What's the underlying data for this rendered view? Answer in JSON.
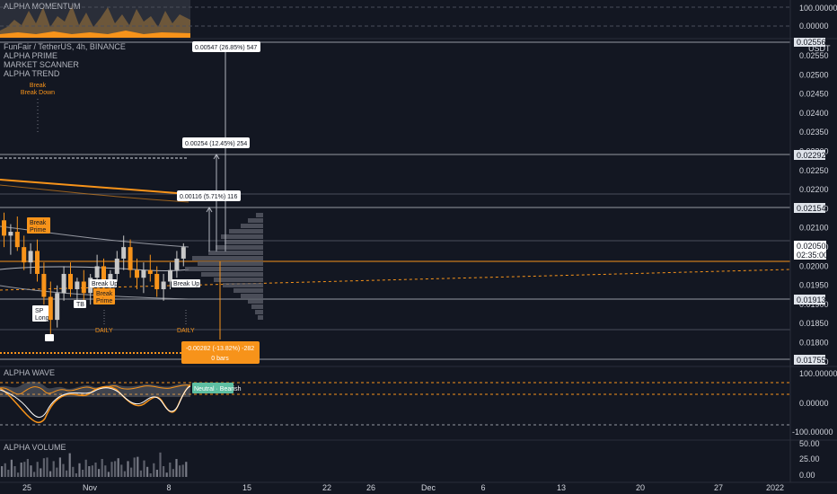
{
  "symbol": {
    "title": "FunFair / TetherUS, 4h, BINANCE"
  },
  "indicators": {
    "prime": "ALPHA PRIME",
    "scanner": "MARKET SCANNER",
    "trend": "ALPHA TREND"
  },
  "top_panel": {
    "label": "ALPHA MOMENTUM",
    "tick_top": "100.00000",
    "tick_zero": "0.00000"
  },
  "currency": "USDT",
  "price_axis": [
    "0.02550",
    "0.02500",
    "0.02450",
    "0.02400",
    "0.02350",
    "0.02300",
    "0.02250",
    "0.02200",
    "0.02150",
    "0.02100",
    "0.02050",
    "0.02000",
    "0.01950",
    "0.01900",
    "0.01850",
    "0.01800",
    "0.01750"
  ],
  "price_tags": {
    "top": "0.02556",
    "t2": "0.02292",
    "t3": "0.02154",
    "current": "0.02050",
    "countdown": "02:35:00",
    "t4": "0.01913",
    "t5": "0.01755"
  },
  "measures": {
    "m1": "0.00547 (26.85%) 547",
    "m2": "0.00254 (12.45%) 254",
    "m3": "0.00116 (5.71%) 116",
    "m4_line1": "-0.00282 (-13.82%) -282",
    "m4_line2": "0 bars"
  },
  "signals": {
    "break1": "Break",
    "break2": "Break Down",
    "prime_a": "Break",
    "prime_b": "Prime",
    "tb": "TB",
    "sp": "SP",
    "long": "Long",
    "break_up1": "Break Up",
    "break_up2": "Break Up",
    "break3": "Break",
    "prime3": "Prime",
    "daily1": "DAILY",
    "daily2": "DAILY"
  },
  "wave": {
    "label": "ALPHA WAVE",
    "tick_top": "100.00000",
    "tick_zero": "0.00000",
    "tick_bottom": "-100.00000",
    "tag": "Neutral · Bearish"
  },
  "volume": {
    "label": "ALPHA VOLUME",
    "tick_top": "50.00",
    "tick_mid": "25.00",
    "tick_bottom": "0.00"
  },
  "time_axis": [
    "25",
    "Nov",
    "8",
    "15",
    "22",
    "26",
    "Dec",
    "6",
    "13",
    "20",
    "27",
    "2022"
  ],
  "colors": {
    "accent": "#f7931a",
    "bg": "#131722",
    "up": "#c8c8c8",
    "down": "#f7931a",
    "tag_bg": "#dfe3ea"
  },
  "chart_data": {
    "type": "candlestick",
    "price_range": [
      0.0174,
      0.0258
    ],
    "candles": [
      [
        0.0212,
        0.0214,
        0.0205,
        0.0208
      ],
      [
        0.0208,
        0.0211,
        0.0203,
        0.0209
      ],
      [
        0.0209,
        0.0213,
        0.0204,
        0.0205
      ],
      [
        0.0205,
        0.0208,
        0.0199,
        0.0201
      ],
      [
        0.0201,
        0.0206,
        0.0198,
        0.0204
      ],
      [
        0.0204,
        0.0207,
        0.0196,
        0.0198
      ],
      [
        0.0198,
        0.0201,
        0.019,
        0.0192
      ],
      [
        0.0192,
        0.0196,
        0.0181,
        0.0186
      ],
      [
        0.0186,
        0.0195,
        0.0184,
        0.0193
      ],
      [
        0.0193,
        0.02,
        0.0191,
        0.0198
      ],
      [
        0.0198,
        0.0201,
        0.0192,
        0.0194
      ],
      [
        0.0194,
        0.0197,
        0.019,
        0.0196
      ],
      [
        0.0196,
        0.0199,
        0.0191,
        0.0193
      ],
      [
        0.0193,
        0.0198,
        0.019,
        0.0197
      ],
      [
        0.0197,
        0.0203,
        0.0195,
        0.02
      ],
      [
        0.02,
        0.0202,
        0.0193,
        0.0195
      ],
      [
        0.0195,
        0.0199,
        0.0191,
        0.0198
      ],
      [
        0.0198,
        0.0204,
        0.0196,
        0.0202
      ],
      [
        0.0202,
        0.0208,
        0.0199,
        0.0205
      ],
      [
        0.0205,
        0.0207,
        0.0197,
        0.0199
      ],
      [
        0.0199,
        0.0202,
        0.0194,
        0.0197
      ],
      [
        0.0197,
        0.0201,
        0.0193,
        0.0199
      ],
      [
        0.0199,
        0.0203,
        0.0196,
        0.0198
      ],
      [
        0.0198,
        0.02,
        0.0192,
        0.0194
      ],
      [
        0.0194,
        0.0198,
        0.0191,
        0.0196
      ],
      [
        0.0196,
        0.0201,
        0.0194,
        0.0199
      ],
      [
        0.0199,
        0.0204,
        0.0197,
        0.0202
      ],
      [
        0.0202,
        0.0206,
        0.02,
        0.0205
      ]
    ]
  }
}
